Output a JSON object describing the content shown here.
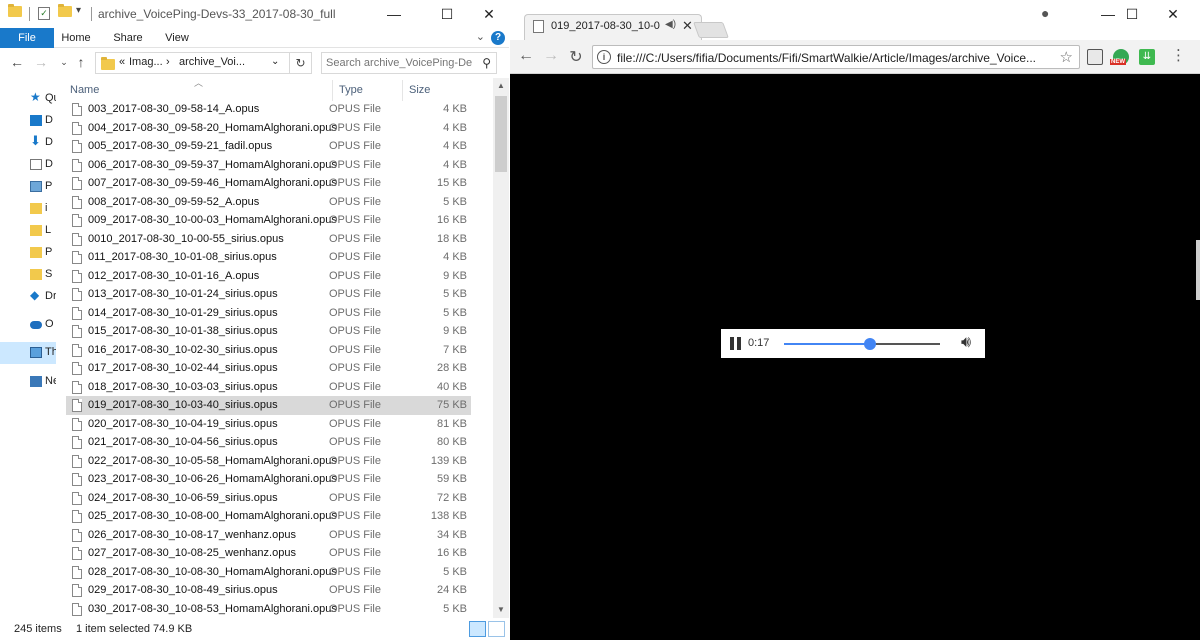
{
  "explorer": {
    "title": "archive_VoicePing-Devs-33_2017-08-30_full",
    "ribbon_tabs": [
      "File",
      "Home",
      "Share",
      "View"
    ],
    "address": {
      "prefix": "«",
      "crumb1": "Imag...",
      "sep": "›",
      "crumb2": "archive_Voi...",
      "dropdown": "⌄"
    },
    "search": {
      "placeholder": "Search archive_VoicePing-Dev..."
    },
    "nav_pane": [
      {
        "label": "Qu",
        "icon": "star-icon"
      },
      {
        "label": "D",
        "icon": "desktop-icon"
      },
      {
        "label": "D",
        "icon": "downloads-icon"
      },
      {
        "label": "D",
        "icon": "documents-icon"
      },
      {
        "label": "P",
        "icon": "pictures-icon"
      },
      {
        "label": "i",
        "icon": "folder-icon"
      },
      {
        "label": "L",
        "icon": "folder-icon"
      },
      {
        "label": "P",
        "icon": "folder-icon"
      },
      {
        "label": "S",
        "icon": "folder-icon"
      },
      {
        "label": "Dr",
        "icon": "dropbox-icon"
      },
      {
        "label": "O",
        "icon": "onedrive-icon"
      },
      {
        "label": "Th",
        "icon": "this-pc-icon"
      },
      {
        "label": "Ne",
        "icon": "network-icon"
      }
    ],
    "columns": {
      "name": "Name",
      "type": "Type",
      "size": "Size"
    },
    "files": [
      {
        "name": "003_2017-08-30_09-58-14_A.opus",
        "type": "OPUS File",
        "size": "4 KB"
      },
      {
        "name": "004_2017-08-30_09-58-20_HomamAlghorani.opus",
        "type": "OPUS File",
        "size": "4 KB"
      },
      {
        "name": "005_2017-08-30_09-59-21_fadil.opus",
        "type": "OPUS File",
        "size": "4 KB"
      },
      {
        "name": "006_2017-08-30_09-59-37_HomamAlghorani.opus",
        "type": "OPUS File",
        "size": "4 KB"
      },
      {
        "name": "007_2017-08-30_09-59-46_HomamAlghorani.opus",
        "type": "OPUS File",
        "size": "15 KB"
      },
      {
        "name": "008_2017-08-30_09-59-52_A.opus",
        "type": "OPUS File",
        "size": "5 KB"
      },
      {
        "name": "009_2017-08-30_10-00-03_HomamAlghorani.opus",
        "type": "OPUS File",
        "size": "16 KB"
      },
      {
        "name": "0010_2017-08-30_10-00-55_sirius.opus",
        "type": "OPUS File",
        "size": "18 KB"
      },
      {
        "name": "011_2017-08-30_10-01-08_sirius.opus",
        "type": "OPUS File",
        "size": "4 KB"
      },
      {
        "name": "012_2017-08-30_10-01-16_A.opus",
        "type": "OPUS File",
        "size": "9 KB"
      },
      {
        "name": "013_2017-08-30_10-01-24_sirius.opus",
        "type": "OPUS File",
        "size": "5 KB"
      },
      {
        "name": "014_2017-08-30_10-01-29_sirius.opus",
        "type": "OPUS File",
        "size": "5 KB"
      },
      {
        "name": "015_2017-08-30_10-01-38_sirius.opus",
        "type": "OPUS File",
        "size": "9 KB"
      },
      {
        "name": "016_2017-08-30_10-02-30_sirius.opus",
        "type": "OPUS File",
        "size": "7 KB"
      },
      {
        "name": "017_2017-08-30_10-02-44_sirius.opus",
        "type": "OPUS File",
        "size": "28 KB"
      },
      {
        "name": "018_2017-08-30_10-03-03_sirius.opus",
        "type": "OPUS File",
        "size": "40 KB"
      },
      {
        "name": "019_2017-08-30_10-03-40_sirius.opus",
        "type": "OPUS File",
        "size": "75 KB",
        "selected": true
      },
      {
        "name": "020_2017-08-30_10-04-19_sirius.opus",
        "type": "OPUS File",
        "size": "81 KB"
      },
      {
        "name": "021_2017-08-30_10-04-56_sirius.opus",
        "type": "OPUS File",
        "size": "80 KB"
      },
      {
        "name": "022_2017-08-30_10-05-58_HomamAlghorani.opus",
        "type": "OPUS File",
        "size": "139 KB"
      },
      {
        "name": "023_2017-08-30_10-06-26_HomamAlghorani.opus",
        "type": "OPUS File",
        "size": "59 KB"
      },
      {
        "name": "024_2017-08-30_10-06-59_sirius.opus",
        "type": "OPUS File",
        "size": "72 KB"
      },
      {
        "name": "025_2017-08-30_10-08-00_HomamAlghorani.opus",
        "type": "OPUS File",
        "size": "138 KB"
      },
      {
        "name": "026_2017-08-30_10-08-17_wenhanz.opus",
        "type": "OPUS File",
        "size": "34 KB"
      },
      {
        "name": "027_2017-08-30_10-08-25_wenhanz.opus",
        "type": "OPUS File",
        "size": "16 KB"
      },
      {
        "name": "028_2017-08-30_10-08-30_HomamAlghorani.opus",
        "type": "OPUS File",
        "size": "5 KB"
      },
      {
        "name": "029_2017-08-30_10-08-49_sirius.opus",
        "type": "OPUS File",
        "size": "24 KB"
      },
      {
        "name": "030_2017-08-30_10-08-53_HomamAlghorani.opus",
        "type": "OPUS File",
        "size": "5 KB"
      }
    ],
    "status": {
      "count": "245 items",
      "selection": "1 item selected  74.9 KB"
    },
    "colors": {
      "accent": "#1979ca",
      "selected_row": "#d9d9d9"
    }
  },
  "chrome": {
    "tab_title": "019_2017-08-30_10-0",
    "url": "file:///C:/Users/fifia/Documents/Fifi/SmartWalkie/Article/Images/archive_Voice...",
    "extension_badge": "NEW",
    "player": {
      "time": "0:17",
      "progress": 0.55,
      "state": "playing"
    },
    "colors": {
      "background": "#000000",
      "progress": "#4285f4"
    }
  }
}
